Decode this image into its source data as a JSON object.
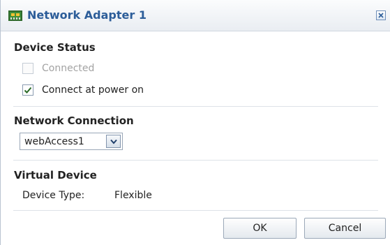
{
  "dialog": {
    "title": "Network Adapter 1",
    "title_icon": "network-card-icon",
    "close_icon": "close-icon"
  },
  "device_status": {
    "title": "Device Status",
    "connected": {
      "label": "Connected",
      "checked": false,
      "disabled": true
    },
    "connect_at_power_on": {
      "label": "Connect at power on",
      "checked": true,
      "disabled": false
    }
  },
  "network_connection": {
    "title": "Network Connection",
    "selected": "webAccess1"
  },
  "virtual_device": {
    "title": "Virtual Device",
    "device_type_label": "Device Type:",
    "device_type_value": "Flexible"
  },
  "buttons": {
    "ok": "OK",
    "cancel": "Cancel"
  },
  "colors": {
    "title_text": "#2c5d99",
    "check_mark": "#2a6a25"
  }
}
